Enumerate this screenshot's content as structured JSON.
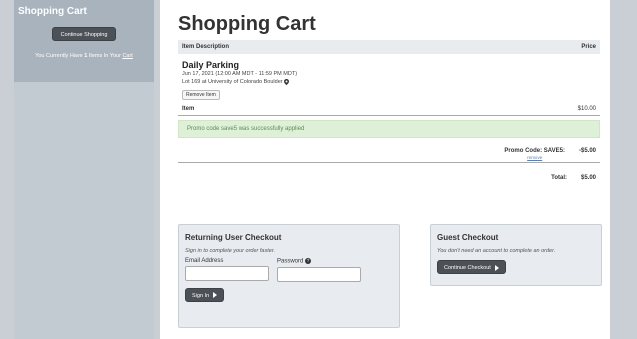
{
  "sidebar": {
    "title": "Shopping Cart",
    "continue_label": "Continue Shopping",
    "count_prefix": "You Currently Have",
    "count": "1",
    "count_middle": "Items In Your",
    "cart_link": "Cart"
  },
  "main": {
    "title": "Shopping Cart",
    "header": {
      "desc": "Item Description",
      "price": "Price"
    },
    "item": {
      "name": "Daily Parking",
      "date": "Jun 17, 2021 (12:00 AM MDT - 11:59 PM MDT)",
      "location": "Lot 169 at University of Colorado Boulder",
      "remove_label": "Remove Item"
    },
    "line": {
      "label": "Item",
      "amount": "$10.00"
    },
    "promo_message": "Promo code save5 was successfully applied",
    "promo": {
      "label": "Promo Code: SAVE5:",
      "remove": "remove",
      "amount": "-$5.00"
    },
    "total": {
      "label": "Total:",
      "amount": "$5.00"
    }
  },
  "returning": {
    "title": "Returning User Checkout",
    "subtitle": "Sign in to complete your order faster.",
    "email_label": "Email Address",
    "password_label": "Password",
    "signin_label": "Sign In"
  },
  "guest": {
    "title": "Guest Checkout",
    "subtitle": "You don't need an account to complete an order.",
    "button_label": "Continue Checkout"
  },
  "colors": {
    "dark_button": "#4b5156",
    "success_bg": "#dff0d8",
    "success_text": "#5a8f4e",
    "sidebar_box": "#a9b3bd"
  }
}
